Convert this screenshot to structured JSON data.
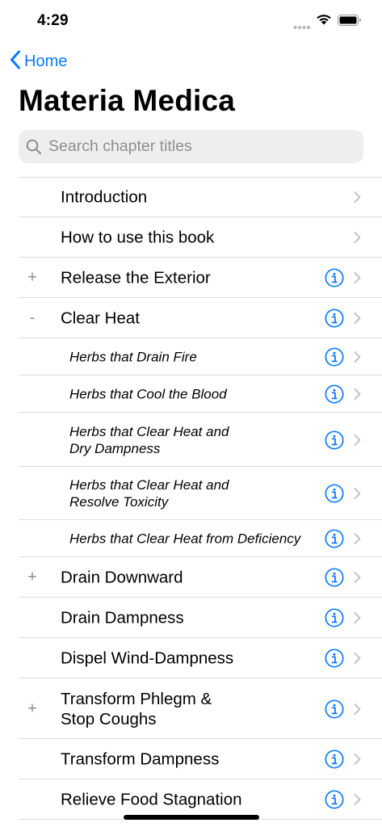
{
  "status_bar": {
    "time": "4:29"
  },
  "nav": {
    "back_label": "Home"
  },
  "page": {
    "title": "Materia Medica"
  },
  "search": {
    "placeholder": "Search chapter titles"
  },
  "colors": {
    "accent": "#0a7aff",
    "separator": "#dcdcde",
    "chevron": "#c4c4c6",
    "secondary": "#8e8e93",
    "search_bg": "#eeeeef"
  },
  "icons": {
    "back": "chevron-left-icon",
    "search": "magnifying-glass-icon",
    "info": "info-circle-icon",
    "disclosure": "chevron-right-icon"
  },
  "chapters": [
    {
      "title": "Introduction",
      "marker": "",
      "info": false,
      "sub": false
    },
    {
      "title": "How to use this book",
      "marker": "",
      "info": false,
      "sub": false
    },
    {
      "title": "Release the Exterior",
      "marker": "+",
      "info": true,
      "sub": false
    },
    {
      "title": "Clear Heat",
      "marker": "-",
      "info": true,
      "sub": false
    },
    {
      "title": "Herbs that Drain Fire",
      "marker": "",
      "info": true,
      "sub": true
    },
    {
      "title": "Herbs that Cool the Blood",
      "marker": "",
      "info": true,
      "sub": true
    },
    {
      "title": "Herbs that Clear Heat and\nDry Dampness",
      "marker": "",
      "info": true,
      "sub": true
    },
    {
      "title": "Herbs that Clear Heat and\nResolve Toxicity",
      "marker": "",
      "info": true,
      "sub": true
    },
    {
      "title": "Herbs that Clear Heat from Deficiency",
      "marker": "",
      "info": true,
      "sub": true
    },
    {
      "title": "Drain Downward",
      "marker": "+",
      "info": true,
      "sub": false
    },
    {
      "title": "Drain Dampness",
      "marker": "",
      "info": true,
      "sub": false
    },
    {
      "title": "Dispel Wind-Dampness",
      "marker": "",
      "info": true,
      "sub": false
    },
    {
      "title": "Transform Phlegm &\nStop Coughs",
      "marker": "+",
      "info": true,
      "sub": false
    },
    {
      "title": "Transform Dampness",
      "marker": "",
      "info": true,
      "sub": false
    },
    {
      "title": "Relieve Food Stagnation",
      "marker": "",
      "info": true,
      "sub": false
    }
  ]
}
